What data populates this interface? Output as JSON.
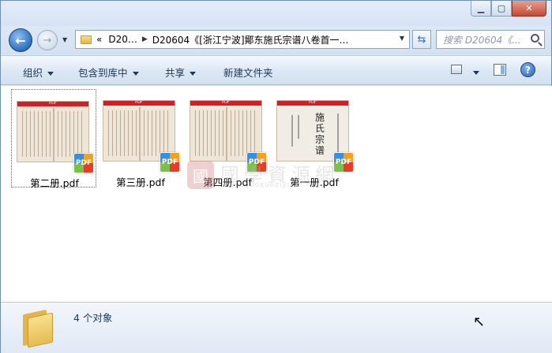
{
  "window": {
    "caption": {
      "minimize": "▁",
      "maximize": "▢",
      "close": "✕"
    }
  },
  "nav": {
    "back_icon": "back-arrow-icon",
    "forward_icon": "forward-arrow-icon",
    "breadcrumb_prefix": "«",
    "crumbs": [
      "D20…",
      "D20604《[浙江宁波]鄮东施氏宗谱八卷首一…"
    ],
    "search_placeholder": "搜索 D20604《..."
  },
  "toolbar": {
    "organize": "组织",
    "include_library": "包含到库中",
    "share": "共享",
    "new_folder": "新建文件夹"
  },
  "files": [
    {
      "name": "第二册.pdf",
      "selected": true,
      "badge": "PDF",
      "banner": "PDF"
    },
    {
      "name": "第三册.pdf",
      "selected": false,
      "badge": "PDF",
      "banner": "PDF"
    },
    {
      "name": "第四册.pdf",
      "selected": false,
      "badge": "PDF",
      "banner": "PDF"
    },
    {
      "name": "第一册.pdf",
      "selected": false,
      "badge": "PDF",
      "banner": "PDF",
      "cover_text": "施氏宗谱"
    }
  ],
  "watermark": {
    "logo": "國",
    "text": "國學資源網",
    "url": "www.guoxueziyuan.net"
  },
  "details": {
    "count_text": "4 个对象"
  },
  "colors": {
    "accent": "#2e6fbf",
    "pdf_banner": "#d11f26",
    "folder": "#e7bb52"
  }
}
